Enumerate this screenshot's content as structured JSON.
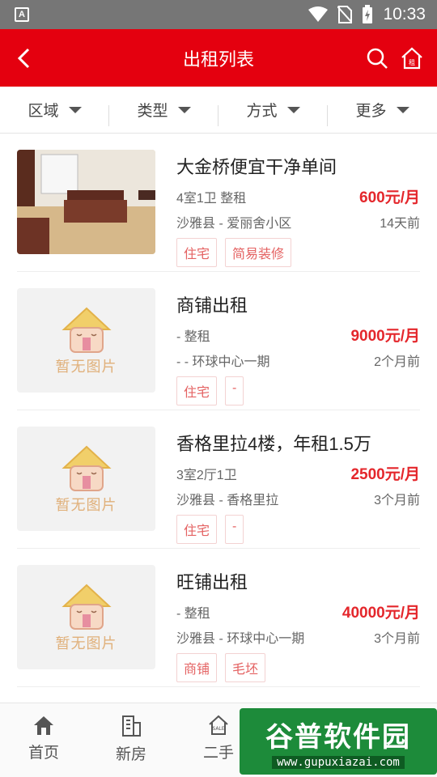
{
  "status_bar": {
    "time": "10:33"
  },
  "header": {
    "title": "出租列表"
  },
  "filters": [
    {
      "label": "区域"
    },
    {
      "label": "类型"
    },
    {
      "label": "方式"
    },
    {
      "label": "更多"
    }
  ],
  "listings": [
    {
      "title": "大金桥便宜干净单间",
      "meta": "4室1卫  整租",
      "price": "600元/月",
      "location": "沙雅县 - 爱丽舍小区",
      "time": "14天前",
      "tags": [
        "住宅",
        "简易装修"
      ],
      "has_photo": true
    },
    {
      "title": "商铺出租",
      "meta": "-  整租",
      "price": "9000元/月",
      "location": "- - 环球中心一期",
      "time": "2个月前",
      "tags": [
        "住宅",
        "-"
      ],
      "has_photo": false
    },
    {
      "title": "香格里拉4楼，年租1.5万",
      "meta": "3室2厅1卫",
      "price": "2500元/月",
      "location": "沙雅县 - 香格里拉",
      "time": "3个月前",
      "tags": [
        "住宅",
        "-"
      ],
      "has_photo": false
    },
    {
      "title": "旺铺出租",
      "meta": "-  整租",
      "price": "40000元/月",
      "location": "沙雅县 - 环球中心一期",
      "time": "3个月前",
      "tags": [
        "商铺",
        "毛坯"
      ],
      "has_photo": false
    }
  ],
  "no_image_text": "暂无图片",
  "tabbar": [
    {
      "label": "首页",
      "icon": "home-icon"
    },
    {
      "label": "新房",
      "icon": "building-icon"
    },
    {
      "label": "二手",
      "icon": "sale-house-icon"
    }
  ],
  "watermark": {
    "brand": "谷普软件园",
    "url": "www.gupuxiazai.com"
  },
  "colors": {
    "accent": "#e4000f",
    "price": "#e4262b"
  }
}
